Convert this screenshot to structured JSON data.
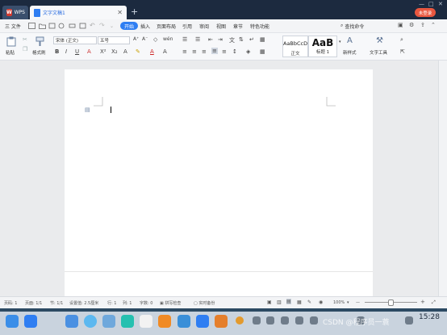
{
  "window": {
    "tabs": [
      {
        "label": "WPS"
      },
      {
        "label": "文字文稿1"
      }
    ],
    "not_logged_in": "未登录"
  },
  "menubar": {
    "file": "三 文件",
    "items": [
      "开始",
      "插入",
      "页面布局",
      "引用",
      "审阅",
      "视图",
      "章节",
      "特色功能"
    ],
    "active": "开始",
    "search": "查找命令"
  },
  "ribbon": {
    "paste": "粘贴",
    "format_painter": "格式刷",
    "font_name": "宋体 (正文)",
    "font_size": "五号",
    "styles": [
      {
        "preview": "AaBbCcD",
        "name": "正文"
      },
      {
        "preview": "AaB",
        "name": "标题 1"
      }
    ],
    "new_style": "新样式",
    "text_tools": "文字工具"
  },
  "statusbar": {
    "page_no": "页码: 1",
    "pages": "页面: 1/1",
    "section": "节: 1/1",
    "setting": "设置值: 2.5厘米",
    "row": "行: 1",
    "col": "列: 1",
    "words": "字数: 0",
    "spell": "拼写检查",
    "backup": "实时备份",
    "zoom": "100%"
  },
  "dock": {
    "clock": "15:28",
    "watermark": "CSDN @程序员一蓑"
  },
  "colors": {
    "accent": "#2f7ef2",
    "wps_red": "#d63a2e",
    "titlebar": "#1c2a3f"
  }
}
